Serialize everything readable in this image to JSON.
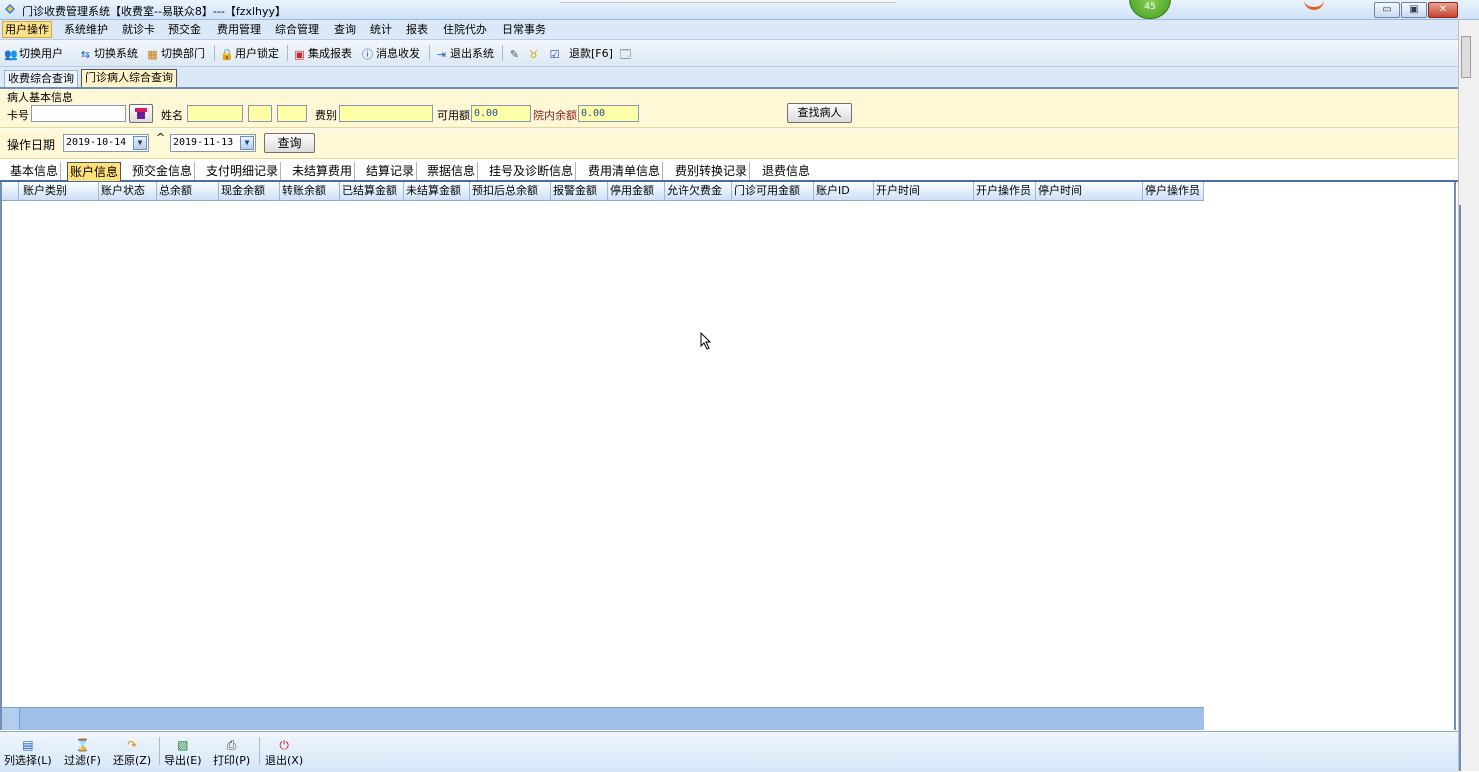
{
  "window": {
    "title": "门诊收费管理系统【收费室--易联众8】---【fzxlhyy】",
    "badge": "45"
  },
  "menu": {
    "items": [
      "用户操作",
      "系统维护",
      "就诊卡",
      "预交金",
      "费用管理",
      "综合管理",
      "查询",
      "统计",
      "报表",
      "住院代办",
      "日常事务"
    ]
  },
  "toolbar": {
    "switch_user": "切换用户",
    "switch_system": "切换系统",
    "switch_dept": "切换部门",
    "lock_user": "用户锁定",
    "report": "集成报表",
    "message": "消息收发",
    "exit": "退出系统",
    "refund": "退款[F6]"
  },
  "module_tabs": [
    "收费综合查询",
    "门诊病人综合查询"
  ],
  "patient": {
    "section_title": "病人基本信息",
    "card_label": "卡号",
    "card_value": "",
    "name_label": "姓名",
    "fee_type_label": "费别",
    "available_label": "可用额",
    "available_value": "0.00",
    "inhospital_label": "院内余额",
    "inhospital_value": "0.00",
    "find_button": "查找病人"
  },
  "query": {
    "date_label": "操作日期",
    "from_date": "2019-10-14",
    "separator": "^",
    "to_date": "2019-11-13",
    "query_button": "查询"
  },
  "sub_tabs": [
    "基本信息",
    "账户信息",
    "预交金信息",
    "支付明细记录",
    "未结算费用",
    "结算记录",
    "票据信息",
    "挂号及诊断信息",
    "费用清单信息",
    "费别转换记录",
    "退费信息"
  ],
  "grid": {
    "columns": [
      "账户类别",
      "账户状态",
      "总余额",
      "现金余额",
      "转账余额",
      "已结算金额",
      "未结算金额",
      "预扣后总余额",
      "报警金额",
      "停用金额",
      "允许欠费金",
      "门诊可用金额",
      "账户ID",
      "开户时间",
      "开户操作员",
      "停户时间",
      "停户操作员"
    ],
    "rows": []
  },
  "bottom_toolbar": {
    "column_select": "列选择(L)",
    "filter": "过滤(F)",
    "restore": "还原(Z)",
    "export": "导出(E)",
    "print": "打印(P)",
    "exit": "退出(X)"
  }
}
